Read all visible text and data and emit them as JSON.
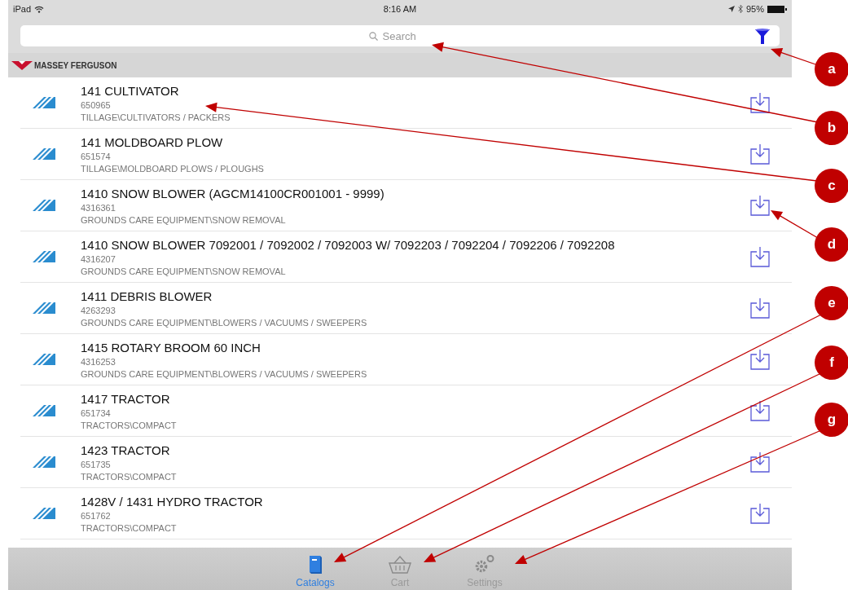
{
  "status_bar": {
    "device": "iPad",
    "time": "8:16 AM",
    "battery": "95%"
  },
  "search": {
    "placeholder": "Search"
  },
  "brand_header": {
    "name": "MASSEY FERGUSON"
  },
  "catalogs": [
    {
      "title": "141 CULTIVATOR",
      "number": "650965",
      "category": "TILLAGE\\CULTIVATORS / PACKERS"
    },
    {
      "title": "141 MOLDBOARD PLOW",
      "number": "651574",
      "category": "TILLAGE\\MOLDBOARD PLOWS / PLOUGHS"
    },
    {
      "title": "1410 SNOW BLOWER (AGCM14100CR001001 - 9999)",
      "number": "4316361",
      "category": "GROUNDS CARE EQUIPMENT\\SNOW REMOVAL"
    },
    {
      "title": "1410 SNOW BLOWER 7092001 / 7092002 / 7092003 W/ 7092203 / 7092204 / 7092206 / 7092208",
      "number": "4316207",
      "category": "GROUNDS CARE EQUIPMENT\\SNOW REMOVAL"
    },
    {
      "title": "1411 DEBRIS BLOWER",
      "number": "4263293",
      "category": "GROUNDS CARE EQUIPMENT\\BLOWERS / VACUUMS / SWEEPERS"
    },
    {
      "title": "1415 ROTARY BROOM 60 INCH",
      "number": "4316253",
      "category": "GROUNDS CARE EQUIPMENT\\BLOWERS / VACUUMS / SWEEPERS"
    },
    {
      "title": "1417 TRACTOR",
      "number": "651734",
      "category": "TRACTORS\\COMPACT"
    },
    {
      "title": "1423 TRACTOR",
      "number": "651735",
      "category": "TRACTORS\\COMPACT"
    },
    {
      "title": "1428V / 1431 HYDRO TRACTOR",
      "number": "651762",
      "category": "TRACTORS\\COMPACT"
    }
  ],
  "tab_bar": [
    {
      "label": "Catalogs",
      "kind": "book",
      "selected": true
    },
    {
      "label": "Cart",
      "kind": "basket",
      "selected": false
    },
    {
      "label": "Settings",
      "kind": "gears",
      "selected": false
    }
  ],
  "callouts": [
    "a",
    "b",
    "c",
    "d",
    "e",
    "f",
    "g"
  ]
}
